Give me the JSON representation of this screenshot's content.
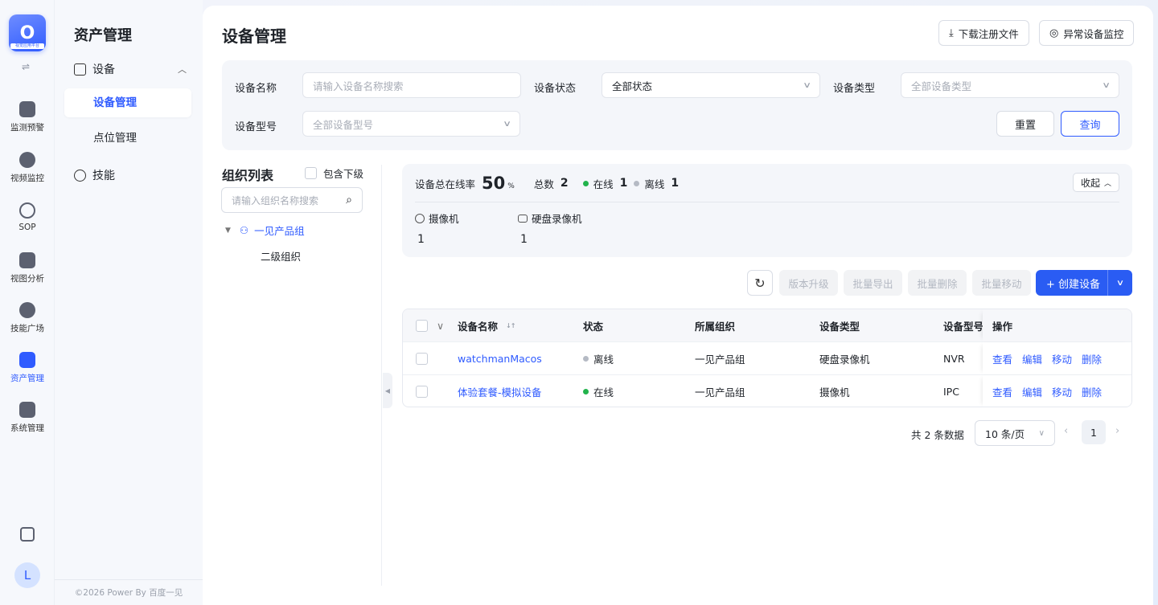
{
  "rail": {
    "logo_tag": "视觉应用平台",
    "items": [
      {
        "label": "监测预警",
        "icon": "chart-icon"
      },
      {
        "label": "视频监控",
        "icon": "camera-icon"
      },
      {
        "label": "SOP",
        "icon": "sop-icon"
      },
      {
        "label": "视图分析",
        "icon": "analysis-icon"
      },
      {
        "label": "技能广场",
        "icon": "skills-icon"
      },
      {
        "label": "资产管理",
        "icon": "asset-icon"
      },
      {
        "label": "系统管理",
        "icon": "system-icon"
      }
    ],
    "active_index": 5,
    "avatar": "L"
  },
  "subnav": {
    "title": "资产管理",
    "group_device": "设备",
    "item_device_mgmt": "设备管理",
    "item_point_mgmt": "点位管理",
    "group_skill": "技能",
    "copyright": "©2026 Power By 百度一见"
  },
  "header": {
    "title": "设备管理",
    "download_btn": "下载注册文件",
    "monitor_btn": "异常设备监控"
  },
  "filters": {
    "name_label": "设备名称",
    "name_placeholder": "请输入设备名称搜索",
    "status_label": "设备状态",
    "status_value": "全部状态",
    "type_label": "设备类型",
    "type_placeholder": "全部设备类型",
    "model_label": "设备型号",
    "model_placeholder": "全部设备型号",
    "reset": "重置",
    "query": "查询"
  },
  "org": {
    "title": "组织列表",
    "include_sub": "包含下级",
    "search_placeholder": "请输入组织名称搜索",
    "root": "一见产品组",
    "child": "二级组织"
  },
  "stats": {
    "online_rate_label": "设备总在线率",
    "online_rate": "50",
    "pct": "%",
    "total_label": "总数",
    "total": "2",
    "online_label": "在线",
    "online": "1",
    "offline_label": "离线",
    "offline": "1",
    "collapse": "收起",
    "types": [
      {
        "label": "摄像机",
        "count": "1"
      },
      {
        "label": "硬盘录像机",
        "count": "1"
      }
    ]
  },
  "toolbar": {
    "upgrade": "版本升级",
    "export": "批量导出",
    "delete": "批量删除",
    "move": "批量移动",
    "create": "+ 创建设备"
  },
  "table": {
    "headers": [
      "设备名称",
      "状态",
      "所属组织",
      "设备类型",
      "设备型号",
      "操作"
    ],
    "rows": [
      {
        "name": "watchmanMacos",
        "status": "离线",
        "org": "一见产品组",
        "type": "硬盘录像机",
        "model": "NVR"
      },
      {
        "name": "体验套餐-模拟设备",
        "status": "在线",
        "org": "一见产品组",
        "type": "摄像机",
        "model": "IPC"
      }
    ],
    "actions": [
      "查看",
      "编辑",
      "移动",
      "删除"
    ]
  },
  "pagination": {
    "total_text": "共 2 条数据",
    "page_size": "10 条/页",
    "current": "1"
  },
  "colors": {
    "accent": "#2f5bff",
    "online": "#22b34c",
    "offline": "#b5bac4"
  }
}
